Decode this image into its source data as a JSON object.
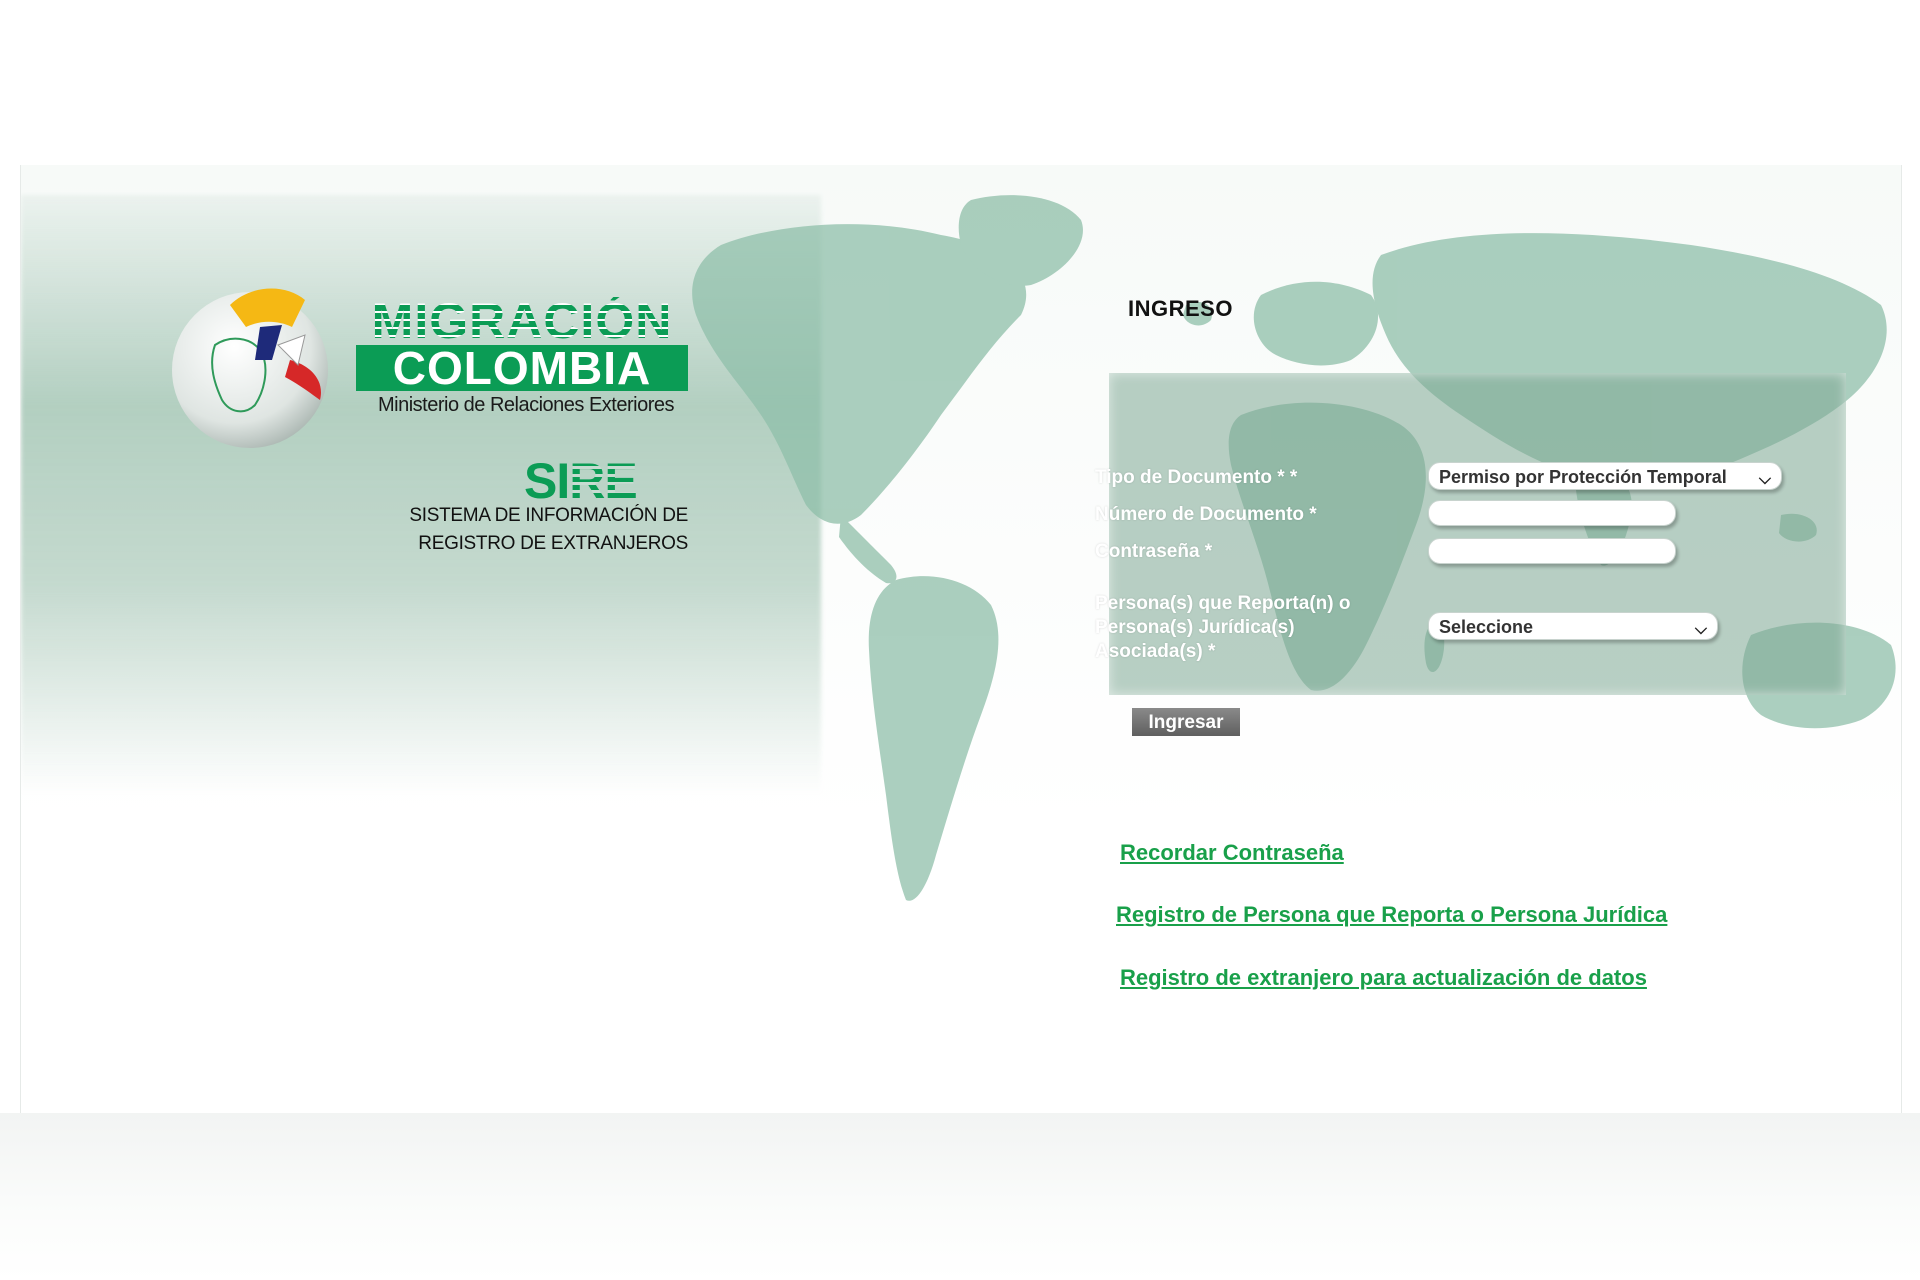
{
  "brand": {
    "line1": "MIGRACIÓN",
    "line2": "COLOMBIA",
    "ministry": "Ministerio de Relaciones Exteriores",
    "sire_a": "SI",
    "sire_b": "RE",
    "sire_subtitle_1": "SISTEMA DE INFORMACIÓN DE",
    "sire_subtitle_2": "REGISTRO DE EXTRANJEROS",
    "green": "#0b9c55"
  },
  "login": {
    "title": "INGRESO",
    "tipo_label": "Tipo de Documento * *",
    "tipo_value": "Permiso por Protección Temporal",
    "numero_label": "Número de Documento *",
    "numero_value": "",
    "password_label": "Contraseña *",
    "password_value": "",
    "persona_label": "Persona(s) que Reporta(n) o Persona(s) Jurídica(s) Asociada(s) *",
    "persona_value": "Seleccione",
    "submit_label": "Ingresar"
  },
  "links": {
    "recordar": "Recordar Contraseña",
    "registro_persona": "Registro de Persona que Reporta o Persona Jurídica",
    "registro_extranjero": "Registro de extranjero para actualización de datos",
    "link_color": "#19a04a"
  },
  "icons": {
    "select_arrow": "chevron-down-icon",
    "logo": "colombia-globe-logo",
    "background": "world-map"
  }
}
